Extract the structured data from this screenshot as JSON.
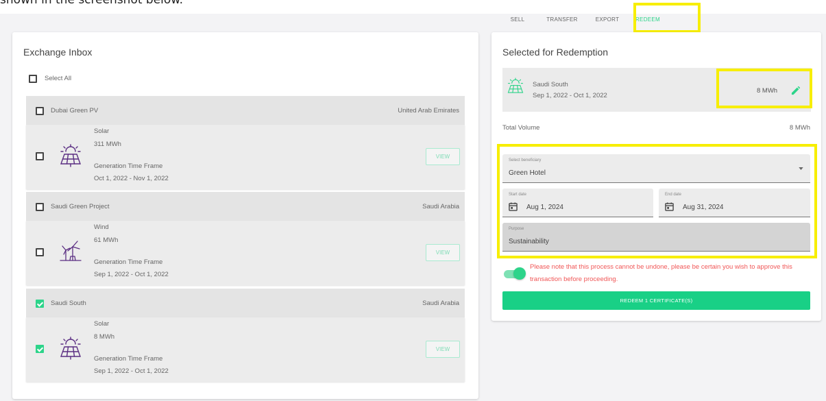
{
  "caption": "shown in the screenshot below.",
  "tabs": [
    {
      "label": "SELL",
      "active": false
    },
    {
      "label": "TRANSFER",
      "active": false
    },
    {
      "label": "EXPORT",
      "active": false
    },
    {
      "label": "REDEEM",
      "active": true
    }
  ],
  "inbox": {
    "title": "Exchange Inbox",
    "select_all": "Select All",
    "groups": [
      {
        "name": "Dubai Green PV",
        "country": "United Arab Emirates",
        "checked": false,
        "asset": {
          "type": "Solar",
          "icon": "solar-panel-icon",
          "volume": "311 MWh",
          "timeframe_label": "Generation Time Frame",
          "timeframe": "Oct 1, 2022 - Nov 1, 2022",
          "checked": false,
          "view": "VIEW"
        }
      },
      {
        "name": "Saudi Green Project",
        "country": "Saudi Arabia",
        "checked": false,
        "asset": {
          "type": "Wind",
          "icon": "wind-turbine-icon",
          "volume": "61 MWh",
          "timeframe_label": "Generation Time Frame",
          "timeframe": "Sep 1, 2022 - Oct 1, 2022",
          "checked": false,
          "view": "VIEW"
        }
      },
      {
        "name": "Saudi South",
        "country": "Saudi Arabia",
        "checked": true,
        "asset": {
          "type": "Solar",
          "icon": "solar-panel-icon",
          "volume": "8 MWh",
          "timeframe_label": "Generation Time Frame",
          "timeframe": "Sep 1, 2022 - Oct 1, 2022",
          "checked": true,
          "view": "VIEW"
        }
      }
    ]
  },
  "redemption": {
    "title": "Selected for Redemption",
    "item": {
      "name": "Saudi South",
      "period": "Sep 1, 2022 - Oct 1, 2022",
      "volume": "8 MWh",
      "icon": "solar-panel-icon"
    },
    "total_label": "Total Volume",
    "total_value": "8 MWh",
    "beneficiary": {
      "label": "Select beneficiary",
      "value": "Green Hotel"
    },
    "start_date": {
      "label": "Start date",
      "value": "Aug 1, 2024"
    },
    "end_date": {
      "label": "End date",
      "value": "Aug 31, 2024"
    },
    "purpose": {
      "label": "Purpose",
      "value": "Sustainability"
    },
    "warning": "Please note that this process cannot be undone, please be certain you wish to approve this transaction before proceeding.",
    "toggle_on": true,
    "button": "REDEEM 1 CERTIFICATE(S)"
  },
  "colors": {
    "accent": "#2dd48a",
    "highlight": "#f7ee00",
    "warning": "#f05656",
    "icon": "#5a2d82"
  }
}
